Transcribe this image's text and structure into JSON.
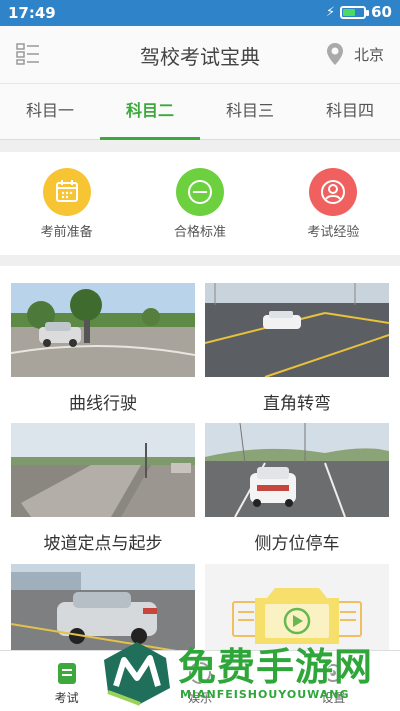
{
  "status_bar": {
    "time": "17:49",
    "battery_percent": "60",
    "battery_level": 0.6
  },
  "header": {
    "title": "驾校考试宝典",
    "location": "北京"
  },
  "tabs": [
    {
      "label": "科目一",
      "active": false
    },
    {
      "label": "科目二",
      "active": true
    },
    {
      "label": "科目三",
      "active": false
    },
    {
      "label": "科目四",
      "active": false
    }
  ],
  "quick_actions": [
    {
      "label": "考前准备",
      "icon": "calendar-icon",
      "color": "#f7c534"
    },
    {
      "label": "合格标准",
      "icon": "minus-circle-icon",
      "color": "#6dd13f"
    },
    {
      "label": "考试经验",
      "icon": "person-icon",
      "color": "#f0605e"
    }
  ],
  "cards": [
    {
      "label": "曲线行驶",
      "icon": "curve-driving-photo"
    },
    {
      "label": "直角转弯",
      "icon": "right-angle-turn-photo"
    },
    {
      "label": "坡道定点与起步",
      "icon": "slope-start-photo"
    },
    {
      "label": "侧方位停车",
      "icon": "parallel-parking-photo"
    },
    {
      "label": "",
      "icon": "car-photo"
    },
    {
      "label": "",
      "icon": "video-placeholder-icon"
    }
  ],
  "bottom_nav": [
    {
      "label": "考试",
      "active": true
    },
    {
      "label": "娱乐",
      "active": false
    },
    {
      "label": "设置",
      "active": false
    }
  ],
  "watermark": {
    "title": "免费手游网",
    "subtitle": "MIANFEISHOUYOUWANG"
  },
  "colors": {
    "status_bar": "#2f83c9",
    "accent_green": "#3da93d"
  }
}
